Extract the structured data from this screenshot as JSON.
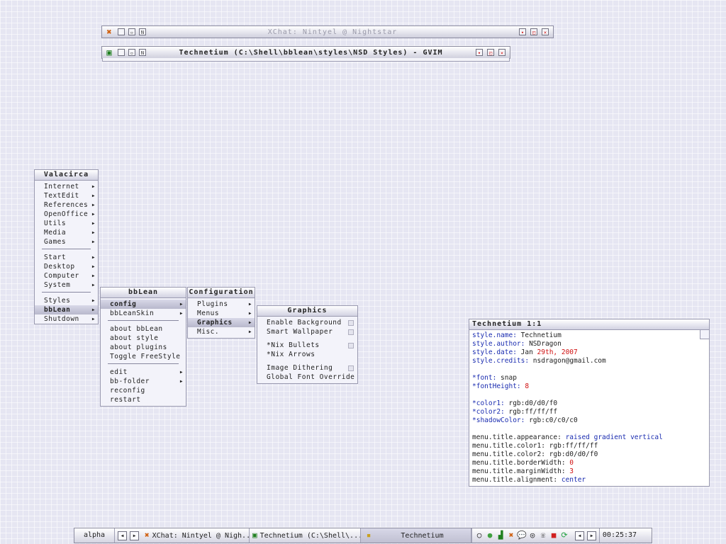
{
  "windows": {
    "xchat": {
      "title": "XChat: Nintyel @ Nightstar",
      "icon": "xchat-icon"
    },
    "gvim": {
      "title": "Technetium (C:\\Shell\\bblean\\styles\\NSD Styles) - GVIM",
      "icon": "gvim-icon"
    }
  },
  "root_menu": {
    "title": "Valacirca",
    "group1": [
      "Internet",
      "TextEdit",
      "References",
      "OpenOffice",
      "Utils",
      "Media",
      "Games"
    ],
    "group2": [
      "Start",
      "Desktop",
      "Computer",
      "System"
    ],
    "group3": [
      "Styles",
      "bbLean",
      "Shutdown"
    ]
  },
  "bblean_menu": {
    "title": "bbLean",
    "group1": [
      "config",
      "bbLeanSkin"
    ],
    "group2": [
      "about bbLean",
      "about style",
      "about plugins",
      "Toggle FreeStyle"
    ],
    "group3": [
      "edit",
      "bb-folder",
      "reconfig",
      "restart"
    ]
  },
  "config_menu": {
    "title": "Configuration",
    "items": [
      "Plugins",
      "Menus",
      "Graphics",
      "Misc."
    ]
  },
  "graphics_menu": {
    "title": "Graphics",
    "group1": [
      "Enable Background",
      "Smart Wallpaper"
    ],
    "group2": [
      "*Nix Bullets",
      "*Nix Arrows"
    ],
    "group3": [
      "Image Dithering",
      "Global Font Override"
    ]
  },
  "editor": {
    "title": "Technetium   1:1",
    "lines": [
      {
        "k": "style.name:",
        "v": " Technetium"
      },
      {
        "k": "style.author:",
        "v": " NSDragon"
      },
      {
        "k": "style.date:",
        "v": " Jan ",
        "r": "29th, 2007"
      },
      {
        "k": "style.credits:",
        "v": " nsdragon@gmail.com"
      },
      {
        "k": "",
        "v": ""
      },
      {
        "k": "*font:",
        "v": " snap"
      },
      {
        "k": "*fontHeight:",
        "r": " 8"
      },
      {
        "k": "",
        "v": ""
      },
      {
        "k": "*color1:",
        "v": " rgb:d0/d0/f0"
      },
      {
        "k": "*color2:",
        "v": " rgb:ff/ff/ff"
      },
      {
        "k": "*shadowColor:",
        "v": " rgb:c0/c0/c0"
      },
      {
        "k": "",
        "v": ""
      },
      {
        "v": "menu.title.appearance:",
        "k": " raised gradient vertical"
      },
      {
        "v": "menu.title.color1:",
        "k2": " rgb:ff/ff/ff"
      },
      {
        "v": "menu.title.color2:",
        "k2": " rgb:d0/d0/f0"
      },
      {
        "v": "menu.title.borderWidth:",
        "r": " 0"
      },
      {
        "v": "menu.title.marginWidth:",
        "r": " 3"
      },
      {
        "v": "menu.title.alignment:",
        "k": " center"
      }
    ]
  },
  "taskbar": {
    "workspace": "alpha",
    "tasks": [
      {
        "label": "XChat: Nintyel @ Nigh...",
        "icon": "xchat-icon"
      },
      {
        "label": "Technetium (C:\\Shell\\...",
        "icon": "gvim-icon"
      },
      {
        "label": "Technetium",
        "icon": "style-icon"
      }
    ],
    "tray_icons": [
      "circle-icon",
      "user-icon",
      "signal-icon",
      "xchat-icon",
      "chat-icon",
      "disc-icon",
      "phone-icon",
      "palette-icon",
      "refresh-icon"
    ],
    "clock": "00:25:37"
  }
}
